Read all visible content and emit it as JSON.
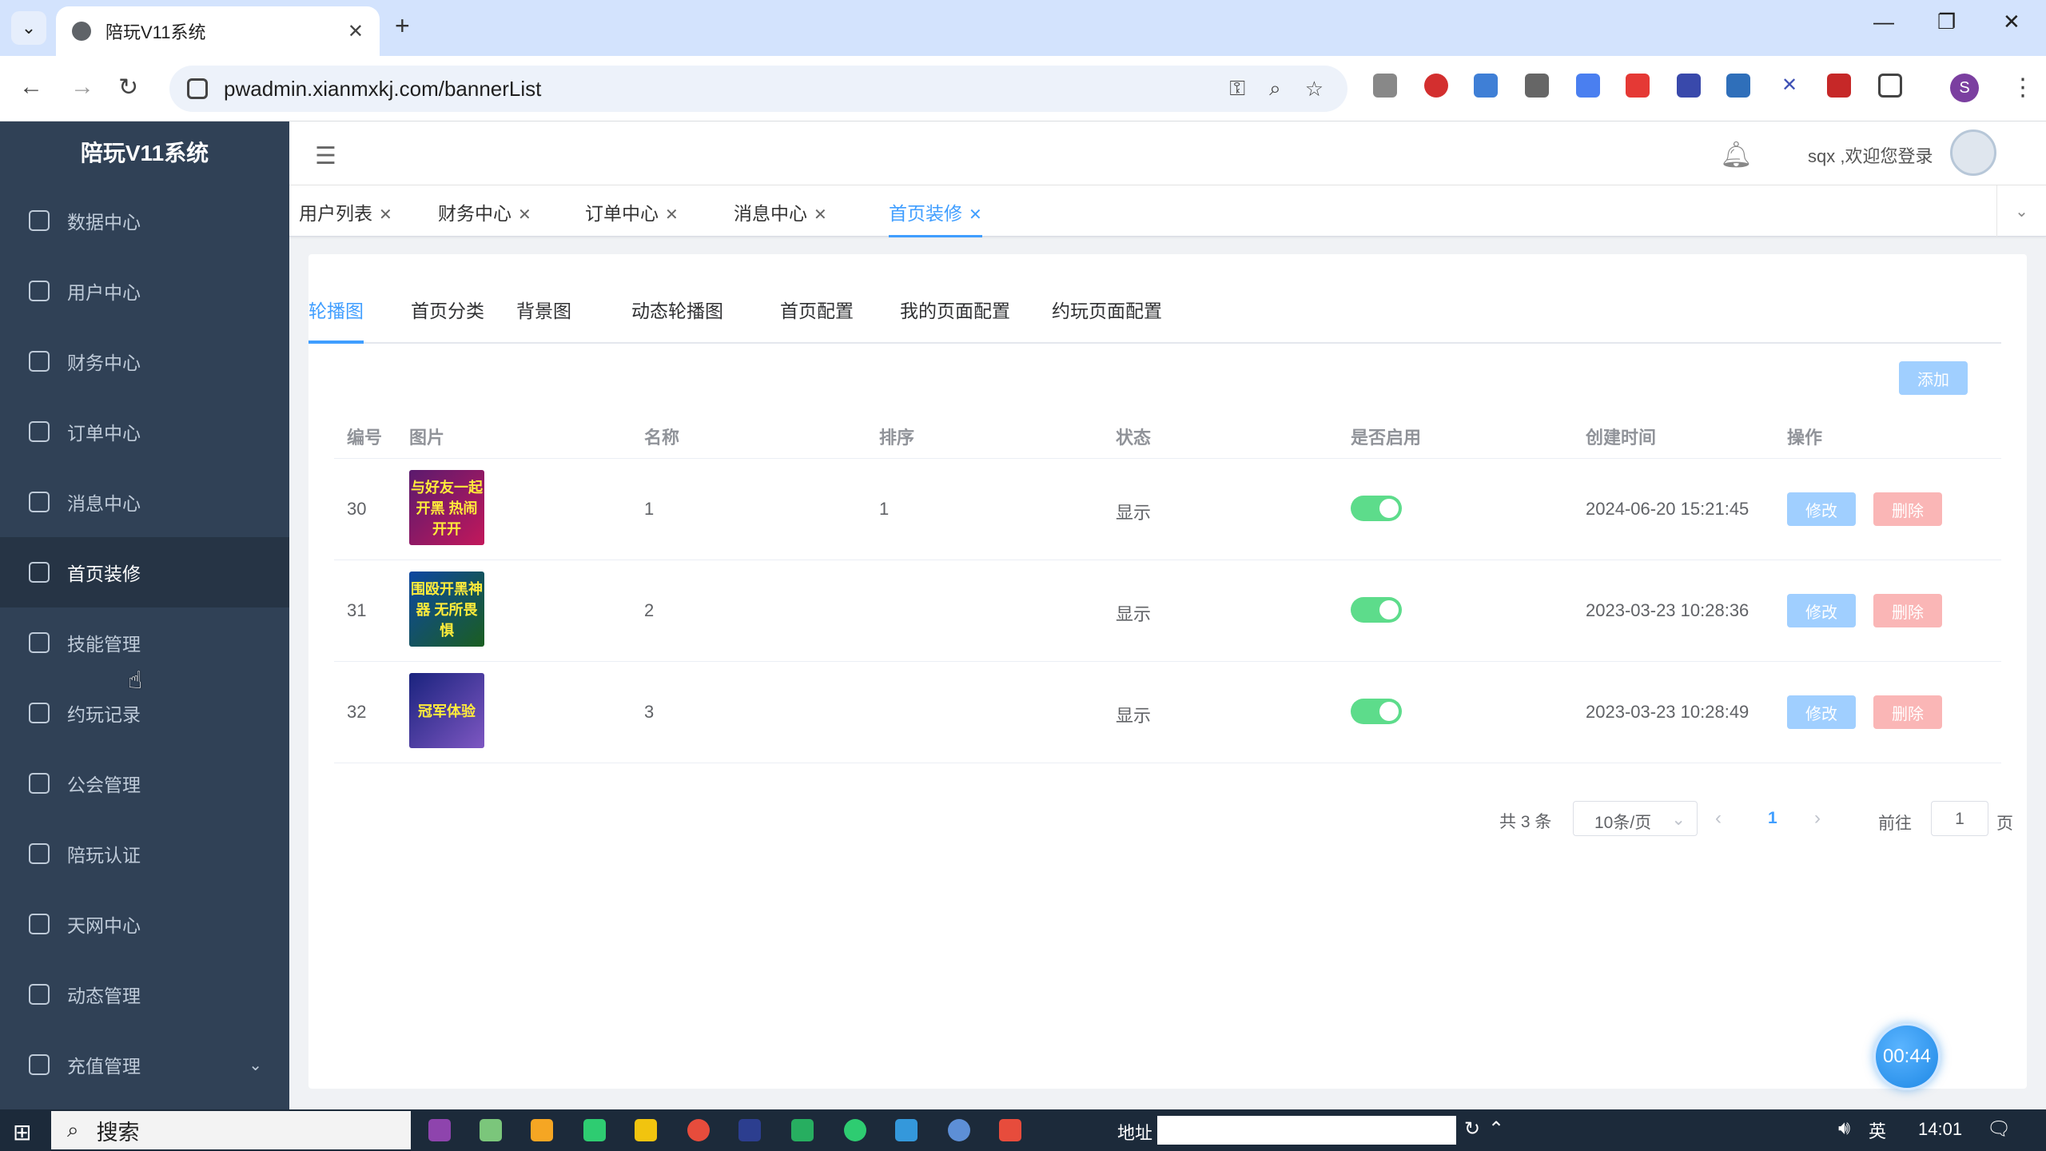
{
  "browser": {
    "tab_title": "陪玩V11系统",
    "url": "pwadmin.xianmxkj.com/bannerList",
    "profile_initial": "S"
  },
  "sidebar": {
    "title": "陪玩V11系统",
    "items": [
      {
        "label": "数据中心",
        "icon": "chart-icon"
      },
      {
        "label": "用户中心",
        "icon": "user-icon"
      },
      {
        "label": "财务中心",
        "icon": "finance-icon"
      },
      {
        "label": "订单中心",
        "icon": "order-icon"
      },
      {
        "label": "消息中心",
        "icon": "message-icon"
      },
      {
        "label": "首页装修",
        "icon": "cube-icon"
      },
      {
        "label": "技能管理",
        "icon": "clipboard-icon"
      },
      {
        "label": "约玩记录",
        "icon": "layers-icon"
      },
      {
        "label": "公会管理",
        "icon": "guild-icon"
      },
      {
        "label": "陪玩认证",
        "icon": "cube-icon"
      },
      {
        "label": "天网中心",
        "icon": "globe-icon"
      },
      {
        "label": "动态管理",
        "icon": "pie-icon"
      },
      {
        "label": "充值管理",
        "icon": "coins-icon"
      }
    ],
    "active_index": 5
  },
  "header": {
    "welcome": "sqx ,欢迎您登录"
  },
  "tags": [
    {
      "label": "用户列表"
    },
    {
      "label": "财务中心"
    },
    {
      "label": "订单中心"
    },
    {
      "label": "消息中心"
    },
    {
      "label": "首页装修",
      "active": true
    }
  ],
  "subtabs": [
    "轮播图",
    "首页分类",
    "背景图",
    "动态轮播图",
    "首页配置",
    "我的页面配置",
    "约玩页面配置"
  ],
  "add_label": "添加",
  "table": {
    "headers": [
      "编号",
      "图片",
      "名称",
      "排序",
      "状态",
      "是否启用",
      "创建时间",
      "操作"
    ],
    "rows": [
      {
        "id": "30",
        "image_text": "与好友一起开黑 热闹开开",
        "name": "1",
        "sort": "1",
        "status": "显示",
        "enabled": true,
        "created": "2024-06-20 15:21:45"
      },
      {
        "id": "31",
        "image_text": "围殴开黑神器 无所畏惧",
        "name": "2",
        "sort": "",
        "status": "显示",
        "enabled": true,
        "created": "2023-03-23 10:28:36"
      },
      {
        "id": "32",
        "image_text": "冠军体验",
        "name": "3",
        "sort": "",
        "status": "显示",
        "enabled": true,
        "created": "2023-03-23 10:28:49"
      }
    ],
    "edit_label": "修改",
    "delete_label": "删除"
  },
  "pagination": {
    "total": "共 3 条",
    "page_size": "10条/页",
    "current": "1",
    "goto_label": "前往",
    "goto_value": "1",
    "page_unit": "页"
  },
  "timer": "00:44",
  "taskbar": {
    "search": "搜索",
    "address_label": "地址",
    "ime": "英",
    "time": "14:01"
  },
  "colors": {
    "sidebar_bg": "#304156",
    "accent": "#409eff",
    "switch_on": "#5ddc8b",
    "danger_light": "#fab6b6"
  }
}
